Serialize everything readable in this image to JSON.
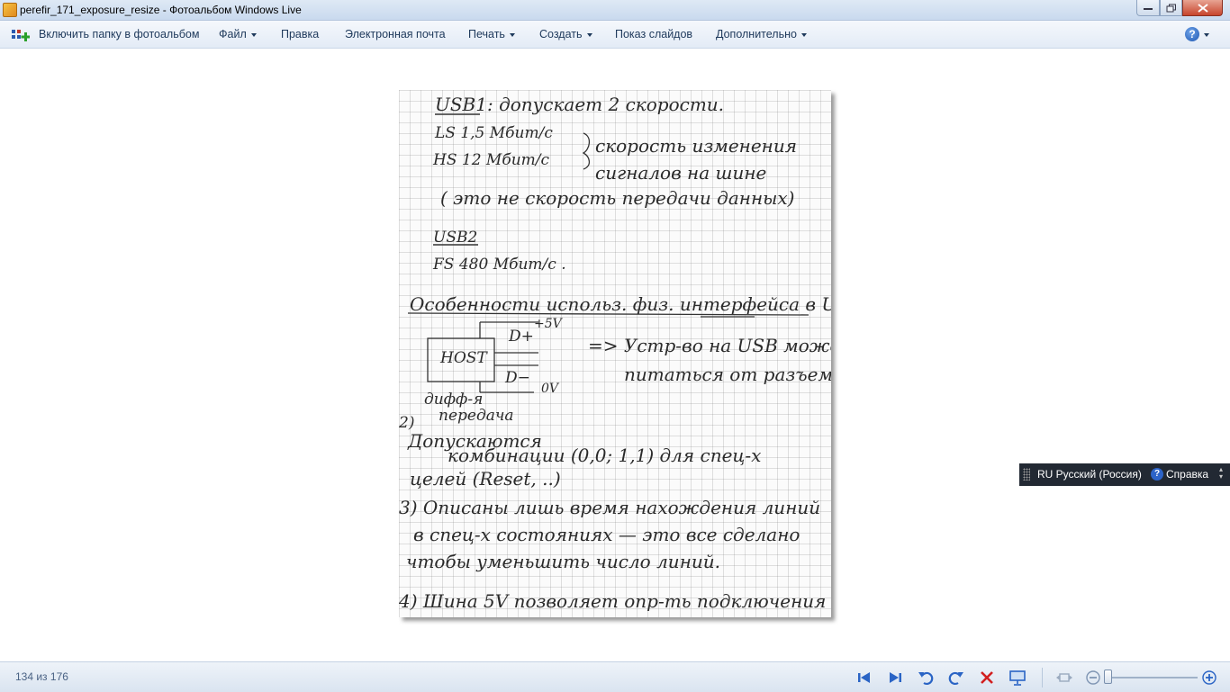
{
  "window": {
    "title": "perefir_171_exposure_resize - Фотоальбом Windows Live"
  },
  "menubar": {
    "include_folder": "Включить папку в фотоальбом",
    "file": "Файл",
    "edit": "Правка",
    "email": "Электронная почта",
    "print": "Печать",
    "create": "Создать",
    "slideshow": "Показ слайдов",
    "more": "Дополнительно"
  },
  "photo": {
    "lines": [
      "USB1: допускает 2 скорости.",
      "LS  1,5 Мбит/с",
      "HS 12 Мбит/с",
      "скорость изменения",
      "сигналов на шине",
      "( это не скорость  передачи данных)",
      "USB2",
      "FS   480 Мбит/с .",
      "Особенности использ. физ. интерфейса в USB",
      "+5V",
      "D+",
      "HOST",
      "D−",
      "0V",
      "=> Устр-во на USB может",
      "питаться от разъема.",
      "дифф-я",
      "передача",
      "2)",
      "Допускаются",
      "комбинации (0,0; 1,1) для спец-х",
      "целей (Reset, ..)",
      "3)  Описаны лишь время нахождения линий",
      "в спец-х состояниях — это все сделано",
      "чтобы уменьшить число линий.",
      "4)  Шина 5V позволяет опр-ть подключения"
    ]
  },
  "langbar": {
    "language": "RU Русский (Россия)",
    "help": "Справка"
  },
  "statusbar": {
    "counter": "134 из 176"
  },
  "colors": {
    "accent_blue": "#2a64c5",
    "delete_red": "#d21f1f",
    "titlebar": "#dfe9f5"
  }
}
